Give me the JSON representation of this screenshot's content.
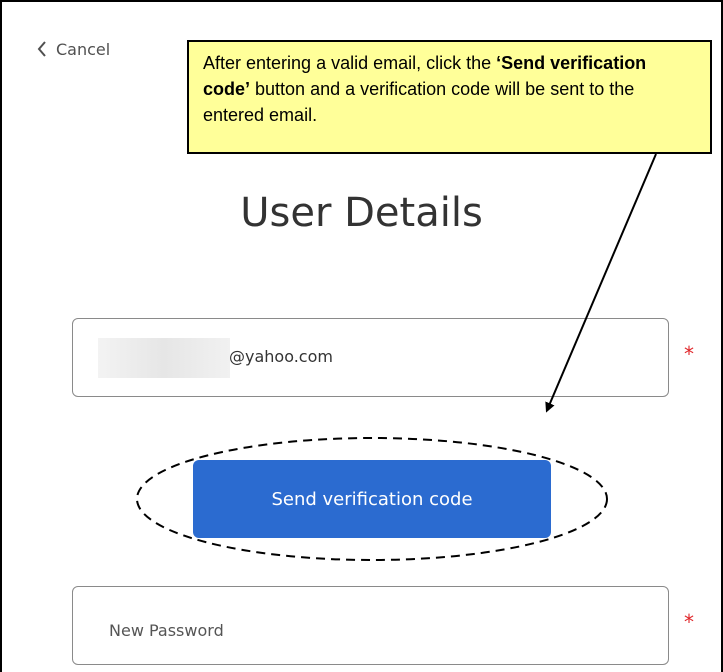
{
  "header": {
    "cancel_label": "Cancel"
  },
  "callout": {
    "text_before": "After entering a valid email, click the ",
    "text_bold": "‘Send verification code’",
    "text_after": " button and a verification code will be sent to the entered email."
  },
  "page": {
    "title": "User Details"
  },
  "email_field": {
    "value_suffix": "@yahoo.com",
    "required_mark": "*"
  },
  "send_button": {
    "label": "Send verification code"
  },
  "password_field": {
    "placeholder": "New Password",
    "required_mark": "*"
  },
  "colors": {
    "button_blue": "#2b6bd0",
    "callout_yellow": "#ffff99",
    "required_red": "#e0262a"
  },
  "icons": {
    "back": "chevron-left-icon"
  }
}
